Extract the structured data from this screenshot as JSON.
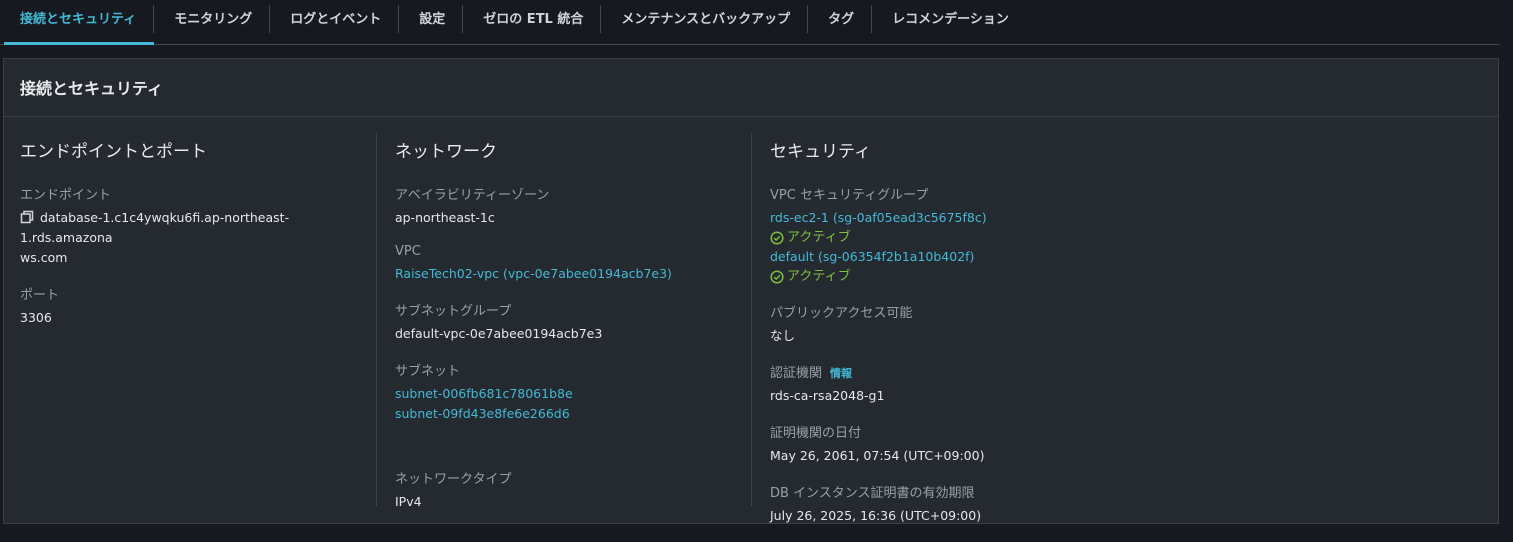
{
  "tabs": [
    {
      "label": "接続とセキュリティ",
      "active": true
    },
    {
      "label": "モニタリング"
    },
    {
      "label": "ログとイベント"
    },
    {
      "label": "設定"
    },
    {
      "label": "ゼロの ETL 統合"
    },
    {
      "label": "メンテナンスとバックアップ"
    },
    {
      "label": "タグ"
    },
    {
      "label": "レコメンデーション"
    }
  ],
  "panel": {
    "title": "接続とセキュリティ",
    "endpoint_col": {
      "title": "エンドポイントとポート",
      "endpoint_label": "エンドポイント",
      "endpoint_line1": "database-1.c1c4ywqku6fi.ap-northeast-1.rds.amazona",
      "endpoint_line2": "ws.com",
      "port_label": "ポート",
      "port_value": "3306"
    },
    "network_col": {
      "title": "ネットワーク",
      "az_label": "アベイラビリティーゾーン",
      "az_value": "ap-northeast-1c",
      "vpc_label": "VPC",
      "vpc_value": "RaiseTech02-vpc (vpc-0e7abee0194acb7e3)",
      "subnet_group_label": "サブネットグループ",
      "subnet_group_value": "default-vpc-0e7abee0194acb7e3",
      "subnet_label": "サブネット",
      "subnets": [
        "subnet-006fb681c78061b8e",
        "subnet-09fd43e8fe6e266d6"
      ],
      "network_type_label": "ネットワークタイプ",
      "network_type_value": "IPv4"
    },
    "security_col": {
      "title": "セキュリティ",
      "sg_label": "VPC セキュリティグループ",
      "sg1": "rds-ec2-1 (sg-0af05ead3c5675f8c)",
      "sg1_status": "アクティブ",
      "sg2": "default (sg-06354f2b1a10b402f)",
      "sg2_status": "アクティブ",
      "public_label": "パブリックアクセス可能",
      "public_value": "なし",
      "ca_label": "認証機関",
      "ca_info": "情報",
      "ca_value": "rds-ca-rsa2048-g1",
      "ca_date_label": "証明機関の日付",
      "ca_date_value": "May 26, 2061, 07:54 (UTC+09:00)",
      "cert_expiry_label": "DB インスタンス証明書の有効期限",
      "cert_expiry_value": "July 26, 2025, 16:36 (UTC+09:00)"
    }
  },
  "colors": {
    "accent": "#44b9d6",
    "status_ok": "#7fbf3f",
    "background": "#16191f",
    "panel": "#252a31"
  }
}
